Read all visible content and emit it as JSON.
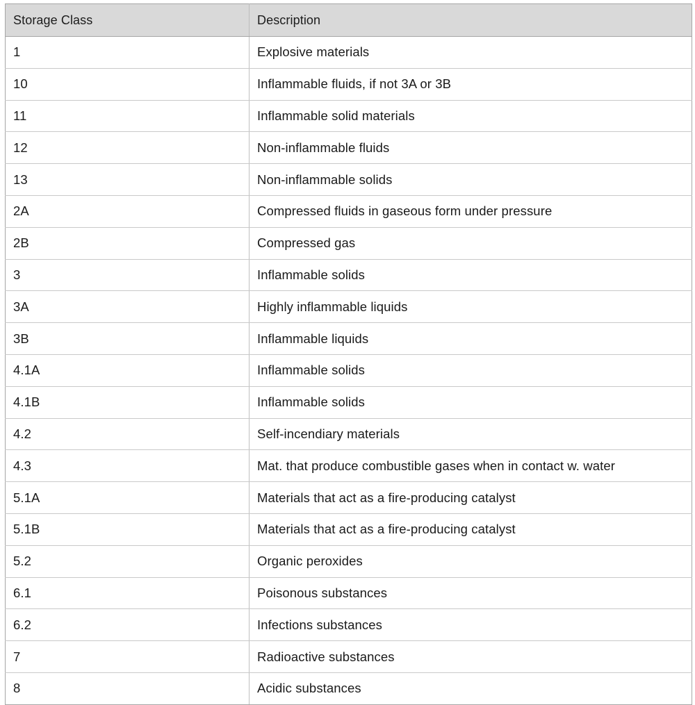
{
  "document": {
    "kind": "data-table",
    "colors": {
      "header_background": "#d9d9d9",
      "body_background": "#ffffff",
      "text": "#1a1a1a",
      "outer_border": "#a6a6a6",
      "inner_gridline": "#c9c9c9"
    }
  },
  "table": {
    "columns": [
      {
        "key": "storage_class",
        "header": "Storage Class"
      },
      {
        "key": "description",
        "header": "Description"
      }
    ],
    "row_count": 21,
    "rows": [
      {
        "storage_class": "1",
        "description": "Explosive materials"
      },
      {
        "storage_class": "10",
        "description": "Inflammable fluids, if not 3A or 3B"
      },
      {
        "storage_class": "11",
        "description": "Inflammable solid materials"
      },
      {
        "storage_class": "12",
        "description": "Non-inflammable fluids"
      },
      {
        "storage_class": "13",
        "description": "Non-inflammable solids"
      },
      {
        "storage_class": "2A",
        "description": "Compressed fluids in gaseous form under pressure"
      },
      {
        "storage_class": "2B",
        "description": "Compressed gas"
      },
      {
        "storage_class": "3",
        "description": "Inflammable solids"
      },
      {
        "storage_class": "3A",
        "description": "Highly inflammable liquids"
      },
      {
        "storage_class": "3B",
        "description": "Inflammable liquids"
      },
      {
        "storage_class": "4.1A",
        "description": "Inflammable solids"
      },
      {
        "storage_class": "4.1B",
        "description": "Inflammable solids"
      },
      {
        "storage_class": "4.2",
        "description": "Self-incendiary materials"
      },
      {
        "storage_class": "4.3",
        "description": "Mat. that produce combustible gases when in contact w. water"
      },
      {
        "storage_class": "5.1A",
        "description": "Materials that act as a fire-producing catalyst"
      },
      {
        "storage_class": "5.1B",
        "description": "Materials that act as a fire-producing catalyst"
      },
      {
        "storage_class": "5.2",
        "description": "Organic peroxides"
      },
      {
        "storage_class": "6.1",
        "description": "Poisonous substances"
      },
      {
        "storage_class": "6.2",
        "description": "Infections substances"
      },
      {
        "storage_class": "7",
        "description": "Radioactive substances"
      },
      {
        "storage_class": "8",
        "description": "Acidic substances"
      }
    ]
  }
}
